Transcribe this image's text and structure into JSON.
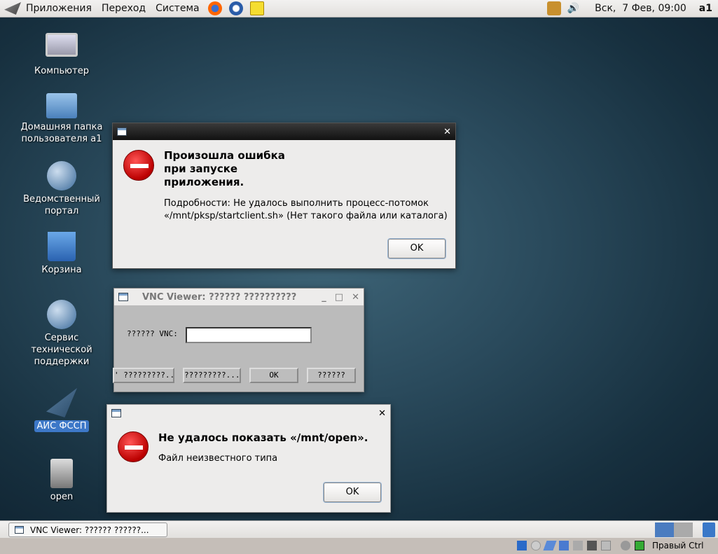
{
  "top_panel": {
    "menus": [
      "Приложения",
      "Переход",
      "Система"
    ],
    "clock": "Вск,  7 Фев, 09:00",
    "user": "a1"
  },
  "desktop": {
    "icons": [
      {
        "label": "Компьютер",
        "icon": "computer-icon"
      },
      {
        "label": "Домашняя папка пользователя a1",
        "icon": "home-folder-icon"
      },
      {
        "label": "Ведомственный портал",
        "icon": "globe-icon"
      },
      {
        "label": "Корзина",
        "icon": "trash-icon"
      },
      {
        "label": "Сервис технической поддержки",
        "icon": "globe-icon"
      },
      {
        "label": "АИС ФССП",
        "icon": "eagle-icon"
      },
      {
        "label": "open",
        "icon": "file-icon"
      }
    ]
  },
  "error_dialog": {
    "title": "Произошла ошибка\nпри запуске\nприложения.",
    "details": "Подробности: Не удалось выполнить процесс-потомок «/mnt/pksp/startclient.sh» (Нет такого файла или каталога)",
    "ok": "OK"
  },
  "vnc": {
    "title": "VNC Viewer: ?????? ??????????",
    "label": "?????? VNC:",
    "value": "",
    "buttons": [
      "' ?????????...",
      "?????????...",
      "OK",
      "??????"
    ]
  },
  "open_dialog": {
    "title": "Не удалось показать «/mnt/open».",
    "details": "Файл неизвестного типа",
    "ok": "OK"
  },
  "taskbar": {
    "items": [
      "VNC Viewer: ?????? ??????..."
    ]
  },
  "vbox": {
    "host_key": "Правый Ctrl"
  }
}
